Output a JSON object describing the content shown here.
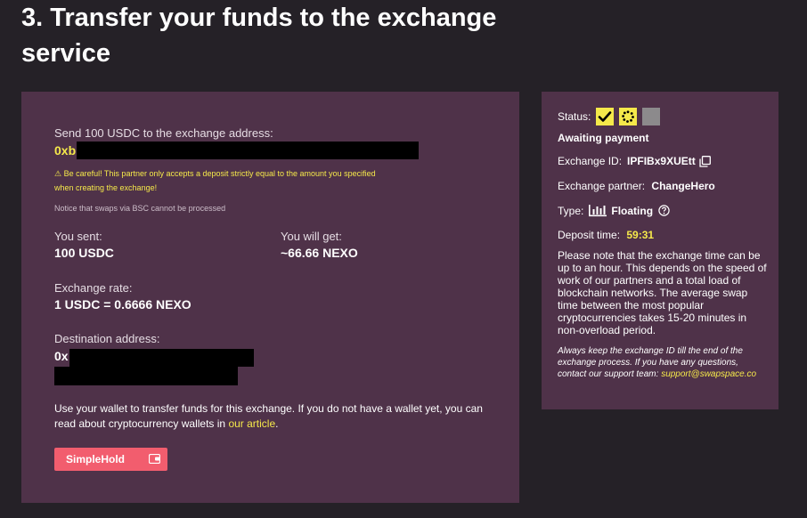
{
  "page": {
    "title": "3. Transfer your funds to the exchange service"
  },
  "main": {
    "send_label": "Send 100 USDC to the exchange address:",
    "deposit_address_prefix": "0xb",
    "warning_line1": "⚠ Be careful! This partner only accepts a deposit strictly equal to the amount you specified",
    "warning_line2": "when creating the exchange!",
    "notice": "Notice that swaps via BSC cannot be processed",
    "you_sent_label": "You sent:",
    "you_sent_value": "100 USDC",
    "you_get_label": "You will get:",
    "you_get_value": "~66.66 NEXO",
    "rate_label": "Exchange rate:",
    "rate_value": "1 USDC = 0.6666 NEXO",
    "destination_label": "Destination address:",
    "destination_prefix": "0x",
    "wallet_text_before": "Use your wallet to transfer funds for this exchange. If you do not have a wallet yet, you can read about cryptocurrency wallets in ",
    "wallet_link": "our article",
    "wallet_text_after": ".",
    "wallet_button": "SimpleHold"
  },
  "side": {
    "status_label": "Status:",
    "status_text": "Awaiting payment",
    "exchange_id_label": "Exchange ID:",
    "exchange_id": "IPFIBx9XUEtt",
    "partner_label": "Exchange partner:",
    "partner": "ChangeHero",
    "type_label": "Type:",
    "type_value": "Floating",
    "deposit_time_label": "Deposit time:",
    "deposit_time": "59:31",
    "note": "Please note that the exchange time can be up to an hour. This depends on the speed of work of our partners and a total load of blockchain networks. The average swap time between the most popular cryptocurrencies takes 15-20 minutes in non-overload period.",
    "support_note": "Always keep the exchange ID till the end of the exchange process. If you have any questions, contact our support team:",
    "support_email": "support@swapspace.co"
  },
  "colors": {
    "background": "#252127",
    "panel": "#4f3249",
    "accent": "#f5e94a",
    "button": "#f25d6e"
  },
  "icons": [
    "check-icon",
    "spinner-icon",
    "copy-icon",
    "bar-chart-icon",
    "help-icon",
    "wallet-icon",
    "warning-icon"
  ]
}
